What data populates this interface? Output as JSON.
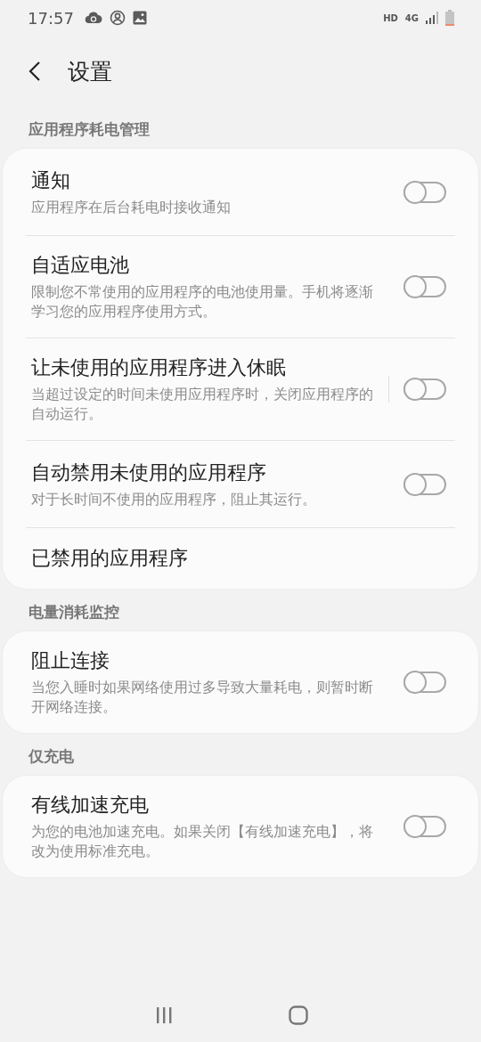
{
  "status_bar": {
    "time": "17:57",
    "hd": "HD",
    "network": "4G"
  },
  "header": {
    "title": "设置"
  },
  "sections": [
    {
      "title": "应用程序耗电管理",
      "items": [
        {
          "title": "通知",
          "subtitle": "应用程序在后台耗电时接收通知",
          "on": false,
          "separated": false
        },
        {
          "title": "自适应电池",
          "subtitle": "限制您不常使用的应用程序的电池使用量。手机将逐渐学习您的应用程序使用方式。",
          "on": false,
          "separated": false
        },
        {
          "title": "让未使用的应用程序进入休眠",
          "subtitle": "当超过设定的时间未使用应用程序时，关闭应用程序的自动运行。",
          "on": false,
          "separated": true
        },
        {
          "title": "自动禁用未使用的应用程序",
          "subtitle": "对于长时间不使用的应用程序，阻止其运行。",
          "on": false,
          "separated": false
        },
        {
          "title": "已禁用的应用程序"
        }
      ]
    },
    {
      "title": "电量消耗监控",
      "items": [
        {
          "title": "阻止连接",
          "subtitle": "当您入睡时如果网络使用过多导致大量耗电，则暂时断开网络连接。",
          "on": false,
          "separated": false
        }
      ]
    },
    {
      "title": "仅充电",
      "items": [
        {
          "title": "有线加速充电",
          "subtitle": "为您的电池加速充电。如果关闭【有线加速充电】，将改为使用标准充电。",
          "on": false,
          "separated": false
        }
      ]
    }
  ]
}
